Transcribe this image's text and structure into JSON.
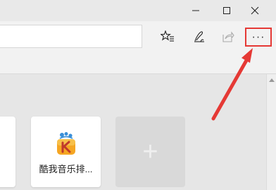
{
  "window_controls": {
    "minimize_icon": "minimize-icon",
    "maximize_icon": "maximize-icon",
    "close_icon": "close-icon"
  },
  "toolbar": {
    "address_value": "",
    "icons": [
      "favorites-star-icon",
      "pen-annotate-icon",
      "share-icon"
    ],
    "more_label": "···"
  },
  "new_tab": {
    "tiles": [
      {
        "label": ""
      },
      {
        "label": "酷我音乐排...",
        "icon": "kuwo-music-icon"
      }
    ],
    "add_tile_label": "+"
  },
  "colors": {
    "highlight": "#e53935",
    "arrow": "#e53935",
    "background": "#e6e6e6"
  }
}
